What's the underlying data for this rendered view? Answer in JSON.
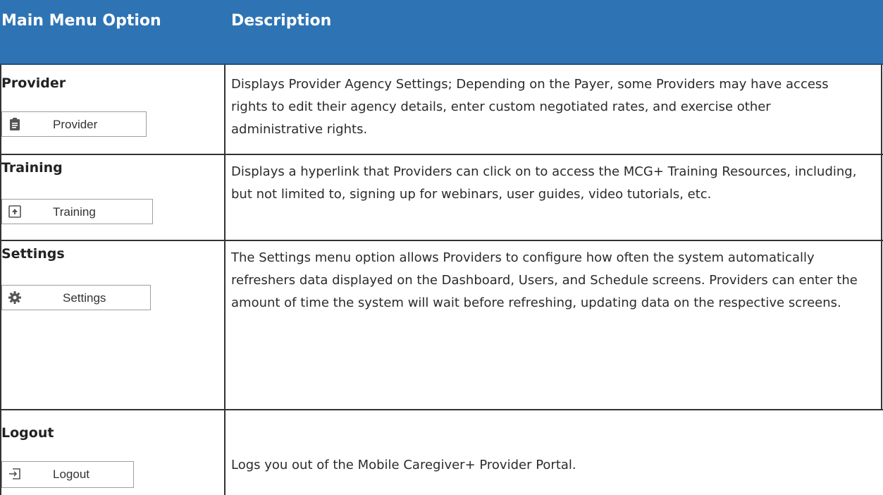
{
  "header": {
    "col1": "Main Menu Option",
    "col2": "Description"
  },
  "rows": [
    {
      "title": "Provider",
      "button_label": "Provider",
      "icon": "clipboard-icon",
      "description": "Displays Provider Agency Settings; Depending on the Payer, some Providers may have access rights to edit their agency details, enter custom negotiated rates, and exercise other administrative rights."
    },
    {
      "title": "Training",
      "button_label": "Training",
      "icon": "upload-box-icon",
      "description": "Displays a hyperlink that Providers can click on to access the MCG+ Training Resources, including, but not limited to, signing up for webinars, user guides, video tutorials, etc."
    },
    {
      "title": "Settings",
      "button_label": "Settings",
      "icon": "gear-icon",
      "description": "The Settings menu option allows Providers to configure how  often the system automatically refreshers data displayed on the Dashboard, Users, and Schedule screens. Providers can enter the amount of time the system will wait before refreshing, updating data on the respective screens."
    },
    {
      "title": "Logout",
      "button_label": "Logout",
      "icon": "logout-icon",
      "description": "Logs you out of the Mobile Caregiver+ Provider Portal."
    }
  ],
  "colors": {
    "header_bg": "#2e74b5",
    "header_text": "#ffffff",
    "border": "#333333"
  }
}
